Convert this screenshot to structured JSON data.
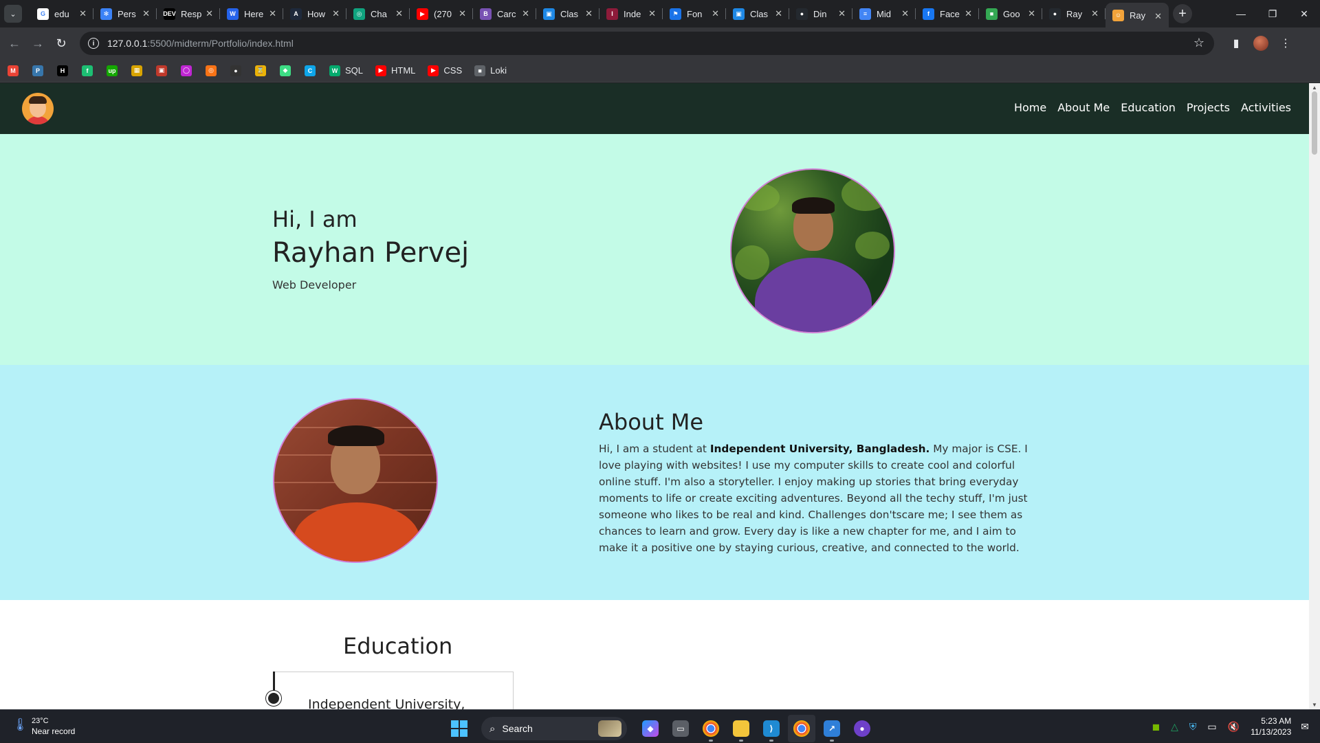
{
  "browser": {
    "tabs": [
      {
        "title": "edu",
        "favicon": "google-icon",
        "color": "#ffffff",
        "glyph": "G"
      },
      {
        "title": "Pers",
        "favicon": "snowflake-icon",
        "color": "#3b82f6",
        "glyph": "✻"
      },
      {
        "title": "Resp",
        "favicon": "dev-icon",
        "color": "#000000",
        "glyph": "DEV"
      },
      {
        "title": "Here",
        "favicon": "w-icon",
        "color": "#2563eb",
        "glyph": "W"
      },
      {
        "title": "How",
        "favicon": "a-icon",
        "color": "#1e293b",
        "glyph": "A"
      },
      {
        "title": "Cha",
        "favicon": "chatgpt-icon",
        "color": "#10a37f",
        "glyph": "◎"
      },
      {
        "title": "(270",
        "favicon": "youtube-icon",
        "color": "#ff0000",
        "glyph": "▶"
      },
      {
        "title": "Carc",
        "favicon": "b-icon",
        "color": "#7952b3",
        "glyph": "B"
      },
      {
        "title": "Clas",
        "favicon": "classroom-icon",
        "color": "#1e88e5",
        "glyph": "▣"
      },
      {
        "title": "Inde",
        "favicon": "iub-icon",
        "color": "#8e1b3a",
        "glyph": "I"
      },
      {
        "title": "Fon",
        "favicon": "flag-icon",
        "color": "#1a73e8",
        "glyph": "⚑"
      },
      {
        "title": "Clas",
        "favicon": "classroom-icon",
        "color": "#1e88e5",
        "glyph": "▣"
      },
      {
        "title": "Din",
        "favicon": "github-icon",
        "color": "#24292f",
        "glyph": "●"
      },
      {
        "title": "Mid",
        "favicon": "docs-icon",
        "color": "#4285f4",
        "glyph": "≡"
      },
      {
        "title": "Face",
        "favicon": "facebook-icon",
        "color": "#1877f2",
        "glyph": "f"
      },
      {
        "title": "Goo",
        "favicon": "meet-icon",
        "color": "#34a853",
        "glyph": "■"
      },
      {
        "title": "Ray",
        "favicon": "github-icon",
        "color": "#24292f",
        "glyph": "●"
      },
      {
        "title": "Ray",
        "favicon": "avatar-icon",
        "color": "#f2a33a",
        "glyph": "☺"
      }
    ],
    "url_host": "127.0.0.1",
    "url_path": ":5500/midterm/Portfolio/index.html",
    "bookmarks": [
      {
        "icon": "gmail-icon",
        "color": "#ea4335",
        "glyph": "M",
        "label": ""
      },
      {
        "icon": "python-icon",
        "color": "#3776ab",
        "glyph": "P",
        "label": ""
      },
      {
        "icon": "hackerrank-icon",
        "color": "#000000",
        "glyph": "H",
        "label": ""
      },
      {
        "icon": "fiverr-icon",
        "color": "#1dbf73",
        "glyph": "f",
        "label": ""
      },
      {
        "icon": "upwork-icon",
        "color": "#14a800",
        "glyph": "up",
        "label": ""
      },
      {
        "icon": "image-icon",
        "color": "#d9a400",
        "glyph": "▦",
        "label": ""
      },
      {
        "icon": "grid-icon",
        "color": "#c0392b",
        "glyph": "▣",
        "label": ""
      },
      {
        "icon": "ring-icon",
        "color": "#c026d3",
        "glyph": "◯",
        "label": ""
      },
      {
        "icon": "target-icon",
        "color": "#f97316",
        "glyph": "◎",
        "label": ""
      },
      {
        "icon": "github-icon",
        "color": "#333333",
        "glyph": "●",
        "label": ""
      },
      {
        "icon": "hourglass-icon",
        "color": "#eab308",
        "glyph": "⌛",
        "label": ""
      },
      {
        "icon": "android-icon",
        "color": "#3ddc84",
        "glyph": "◆",
        "label": ""
      },
      {
        "icon": "c-icon",
        "color": "#0ea5e9",
        "glyph": "C",
        "label": ""
      },
      {
        "icon": "w3schools-icon",
        "color": "#04aa6d",
        "glyph": "W",
        "label": "SQL"
      },
      {
        "icon": "youtube-icon",
        "color": "#ff0000",
        "glyph": "▶",
        "label": "HTML"
      },
      {
        "icon": "youtube-icon",
        "color": "#ff0000",
        "glyph": "▶",
        "label": "CSS"
      },
      {
        "icon": "folder-icon",
        "color": "#5f6368",
        "glyph": "■",
        "label": "Loki"
      }
    ]
  },
  "site": {
    "nav": [
      "Home",
      "About Me",
      "Education",
      "Projects",
      "Activities"
    ],
    "hero": {
      "greeting": "Hi, I am",
      "name": "Rayhan Pervej",
      "role": "Web Developer"
    },
    "about": {
      "heading": "About Me",
      "intro": "Hi, I am a student at ",
      "school": "Independent University, Bangladesh.",
      "body": " My major is CSE. I love playing with websites! I use my computer skills to create cool and colorful online stuff. I'm also a storyteller. I enjoy making up stories that bring everyday moments to life or create exciting adventures. Beyond all the techy stuff, I'm just someone who likes to be real and kind. Challenges don'tscare me; I see them as chances to learn and grow. Every day is like a new chapter for me, and I aim to make it a positive one by staying curious, creative, and connected to the world."
    },
    "education": {
      "heading": "Education",
      "first_entry": "Independent University,"
    }
  },
  "taskbar": {
    "weather_temp": "23°C",
    "weather_desc": "Near record",
    "search_placeholder": "Search",
    "time": "5:23 AM",
    "date": "11/13/2023"
  }
}
